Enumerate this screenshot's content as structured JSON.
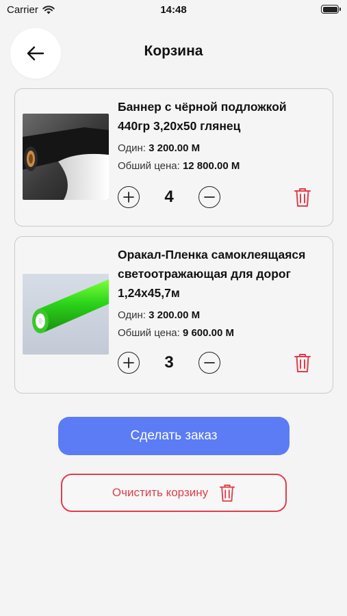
{
  "status_bar": {
    "carrier": "Carrier",
    "time": "14:48"
  },
  "header": {
    "title": "Корзина",
    "back_icon": "arrow-left-icon"
  },
  "cart_items": [
    {
      "name": "Баннер с чёрной подложкой 440гр 3,20х50 глянец",
      "unit_price_label": "Один:",
      "unit_price": "3 200.00 M",
      "total_label": "Обший цена:",
      "total": "12 800.00 M",
      "quantity": "4",
      "image": "black-banner-roll"
    },
    {
      "name": "Оракал-Пленка самоклеящаяся светоотражающая для дорог 1,24х45,7м",
      "unit_price_label": "Один:",
      "unit_price": "3 200.00 M",
      "total_label": "Обший цена:",
      "total": "9 600.00 M",
      "quantity": "3",
      "image": "green-reflective-film-roll"
    }
  ],
  "actions": {
    "order_label": "Сделать заказ",
    "clear_label": "Очистить корзину"
  },
  "colors": {
    "accent": "#5b7cf5",
    "danger": "#e23c4a",
    "background": "#f4f4f4"
  }
}
